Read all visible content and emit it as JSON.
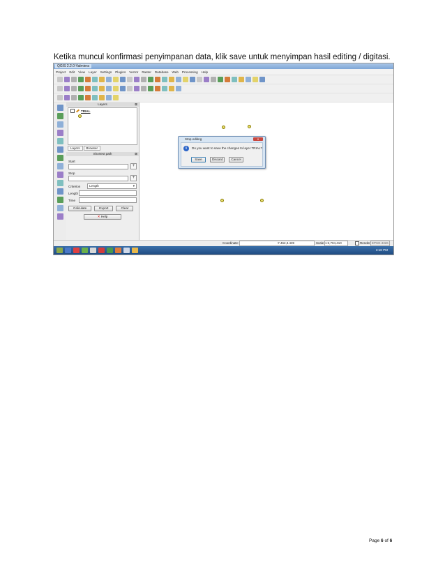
{
  "caption": "Ketika muncul konfirmasi penyimpanan data, klik save untuk menyimpan hasil editing / digitasi.",
  "qgis": {
    "window_title": "QGIS 2.2.0-Valmiera",
    "menu": [
      "Project",
      "Edit",
      "View",
      "Layer",
      "Settings",
      "Plugins",
      "Vector",
      "Raster",
      "Database",
      "Web",
      "Processing",
      "Help"
    ],
    "layers_panel": {
      "title": "Layers",
      "close": "⊠",
      "layer_name": "TRIAL",
      "tabs": [
        "Layers",
        "Browser"
      ]
    },
    "shortest_path": {
      "title": "Shortest path",
      "start_label": "Start",
      "stop_label": "Stop",
      "criterion_label": "Criterion",
      "criterion_value": "Length",
      "length_label": "Length",
      "time_label": "Time",
      "calculate": "Calculate",
      "export": "Export",
      "clear": "Clear",
      "help": "Help"
    },
    "dialog": {
      "title": "Stop editing",
      "close": "x",
      "info_glyph": "i",
      "message": "Do you want to save the changes to layer TRIAL?",
      "save": "Save",
      "discard": "Discard",
      "cancel": "Cancel"
    },
    "status": {
      "coordinate_label": "Coordinate:",
      "coordinate_value": "-7.462,3.439",
      "scale_label": "Scale",
      "scale_value": "1:2,704,410",
      "render_label": "Render",
      "crs": "EPSG:4326"
    },
    "taskbar_time": "3:18 PM"
  },
  "footer": {
    "page_label": "Page",
    "page_num": "6",
    "of_label": "of",
    "page_total": "6"
  }
}
